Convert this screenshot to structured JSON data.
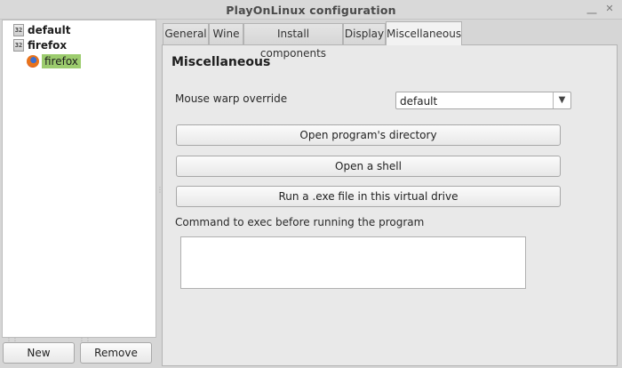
{
  "window": {
    "title": "PlayOnLinux configuration",
    "minimize_glyph": "⎽",
    "close_glyph": "✕"
  },
  "sidebar": {
    "items": [
      {
        "label": "default",
        "icon": "wine-32-icon",
        "icon_text": "32"
      },
      {
        "label": "firefox",
        "icon": "wine-32-icon",
        "icon_text": "32"
      },
      {
        "label": "firefox",
        "icon": "firefox-icon",
        "selected": true
      }
    ],
    "new_label": "New",
    "remove_label": "Remove"
  },
  "tabs": [
    {
      "label": "General"
    },
    {
      "label": "Wine"
    },
    {
      "label": "Install components"
    },
    {
      "label": "Display"
    },
    {
      "label": "Miscellaneous",
      "active": true
    }
  ],
  "misc": {
    "title": "Miscellaneous",
    "mouse_warp_label": "Mouse warp override",
    "mouse_warp_value": "default",
    "open_dir_label": "Open program's directory",
    "open_shell_label": "Open a shell",
    "run_exe_label": "Run a .exe file in this virtual drive",
    "command_label": "Command to exec before running the program",
    "command_value": ""
  },
  "colors": {
    "selection": "#9ccc6e",
    "background": "#d6d6d6",
    "panel": "#e9e9e9"
  }
}
